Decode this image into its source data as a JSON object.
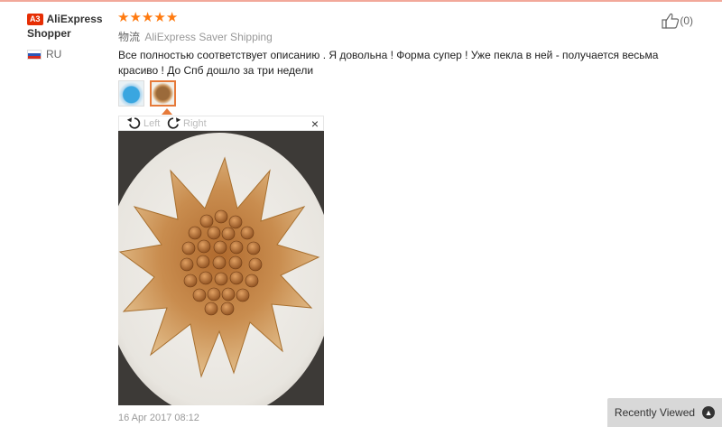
{
  "user": {
    "badge": "A3",
    "name": "AliExpress Shopper",
    "country": "RU",
    "flag_colors": [
      "#ffffff",
      "#2b56b8",
      "#d52b1e"
    ]
  },
  "review": {
    "rating": 5,
    "stars": [
      "★",
      "★",
      "★",
      "★",
      "★"
    ],
    "shipping_label_cn": "物流",
    "shipping_method": "AliExpress Saver Shipping",
    "text": "Все полностью соответствует описанию . Я довольна ! Форма супер ! Уже пекла в ней - получается весьма красиво ! До Спб дошло за три недели",
    "date": "16 Apr 2017 08:12"
  },
  "viewer": {
    "rotate_left": "Left",
    "rotate_right": "Right",
    "close": "×"
  },
  "helpful": {
    "count": "(0)"
  },
  "recently_viewed": {
    "label": "Recently Viewed",
    "icon": "chevron-up-icon"
  },
  "colors": {
    "star": "#ff7a0f",
    "badge": "#e62e04",
    "active_thumb": "#e67a3a"
  }
}
